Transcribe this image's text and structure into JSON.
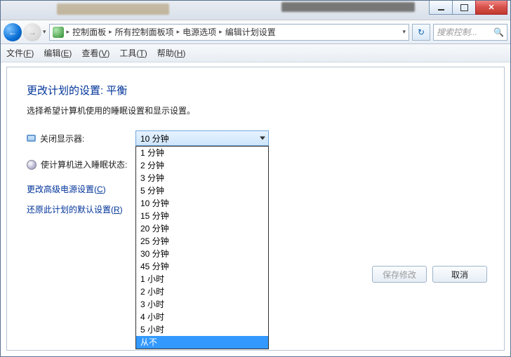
{
  "titlebar": {
    "min": "min",
    "max": "max",
    "close": "close"
  },
  "nav": {
    "back_arrow": "←",
    "fwd_arrow": "→",
    "drop": "▾"
  },
  "breadcrumb": {
    "items": [
      "控制面板",
      "所有控制面板项",
      "电源选项",
      "编辑计划设置"
    ],
    "sep": "▸",
    "refresh": "↻"
  },
  "search": {
    "placeholder": "搜索控制...",
    "icon": "🔍"
  },
  "menu": {
    "file": "文件(",
    "file_u": "F",
    "file2": ")",
    "edit": "编辑(",
    "edit_u": "E",
    "edit2": ")",
    "view": "查看(",
    "view_u": "V",
    "view2": ")",
    "tools": "工具(",
    "tools_u": "T",
    "tools2": ")",
    "help": "帮助(",
    "help_u": "H",
    "help2": ")"
  },
  "page": {
    "heading": "更改计划的设置: 平衡",
    "sub": "选择希望计算机使用的睡眠设置和显示设置。",
    "label_display": "关闭显示器:",
    "label_sleep": "使计算机进入睡眠状态:",
    "combo_value": "10 分钟",
    "link_adv_a": "更改高级电源设置(",
    "link_adv_u": "C",
    "link_adv_b": ")",
    "link_restore_a": "还原此计划的默认设置(",
    "link_restore_u": "R",
    "link_restore_b": ")"
  },
  "dropdown_options": [
    "1 分钟",
    "2 分钟",
    "3 分钟",
    "5 分钟",
    "10 分钟",
    "15 分钟",
    "20 分钟",
    "25 分钟",
    "30 分钟",
    "45 分钟",
    "1 小时",
    "2 小时",
    "3 小时",
    "4 小时",
    "5 小时",
    "从不"
  ],
  "dropdown_selected": "从不",
  "buttons": {
    "save": "保存修改",
    "cancel": "取消"
  }
}
